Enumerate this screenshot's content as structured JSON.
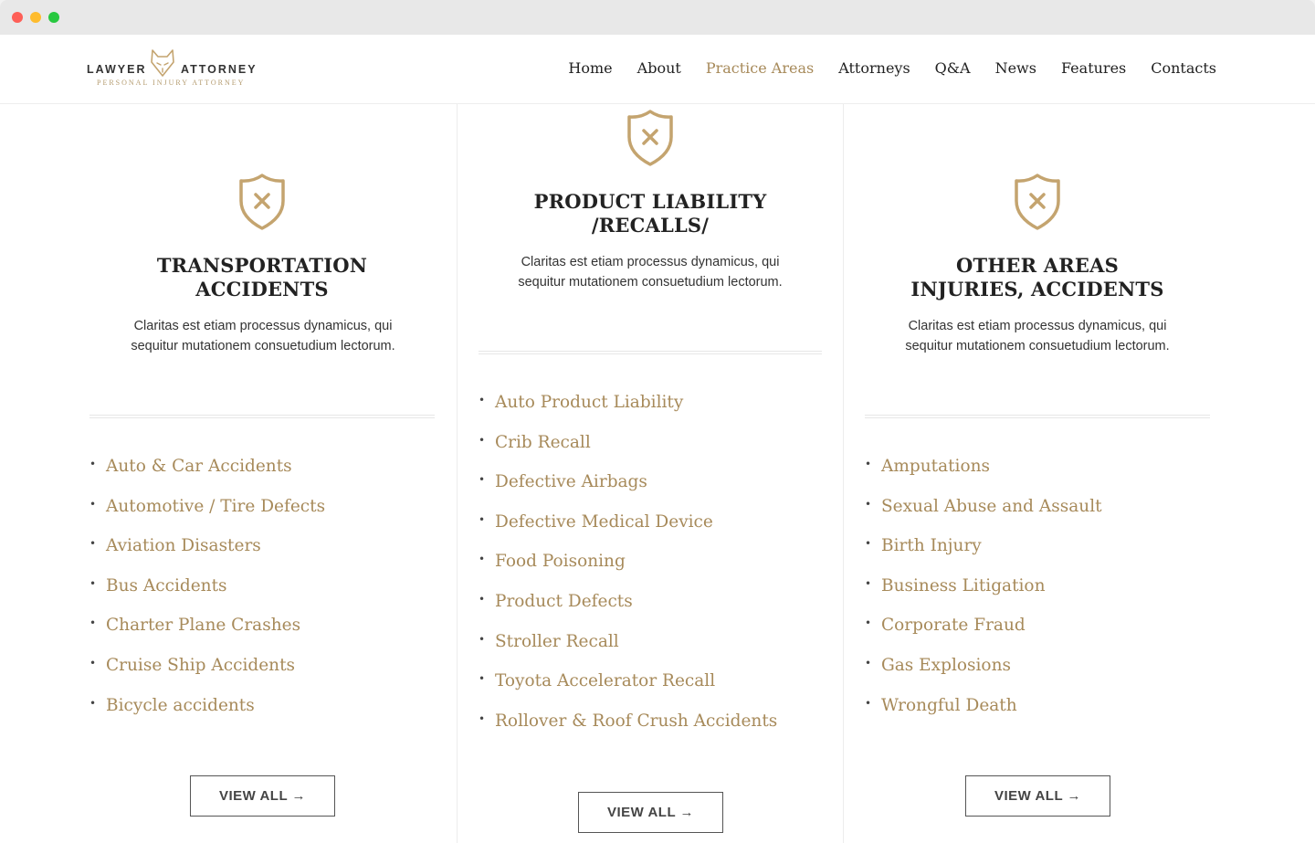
{
  "logo": {
    "left_word": "LAWYER",
    "right_word": "ATTORNEY",
    "tagline": "PERSONAL INJURY ATTORNEY"
  },
  "nav": [
    {
      "label": "Home",
      "active": false
    },
    {
      "label": "About",
      "active": false
    },
    {
      "label": "Practice Areas",
      "active": true
    },
    {
      "label": "Attorneys",
      "active": false
    },
    {
      "label": "Q&A",
      "active": false
    },
    {
      "label": "News",
      "active": false
    },
    {
      "label": "Features",
      "active": false
    },
    {
      "label": "Contacts",
      "active": false
    }
  ],
  "colors": {
    "accent": "#a78a5a",
    "text": "#222222"
  },
  "columns": [
    {
      "icon": "shield-x-icon",
      "title_line1": "TRANSPORTATION",
      "title_line2": "ACCIDENTS",
      "description": "Claritas est etiam processus dynamicus, qui sequitur mutationem consuetudium lectorum.",
      "items": [
        "Auto & Car Accidents",
        "Automotive / Tire Defects",
        "Aviation Disasters",
        "Bus Accidents",
        "Charter Plane Crashes",
        "Cruise Ship Accidents",
        "Bicycle accidents"
      ],
      "button": "VIEW ALL →"
    },
    {
      "icon": "shield-x-icon",
      "title_line1": "PRODUCT LIABILITY",
      "title_line2": "/RECALLS/",
      "description": "Claritas est etiam processus dynamicus, qui sequitur mutationem consuetudium lectorum.",
      "items": [
        "Auto Product Liability",
        "Crib Recall",
        "Defective Airbags",
        "Defective Medical Device",
        "Food Poisoning",
        "Product Defects",
        "Stroller Recall",
        "Toyota Accelerator Recall",
        "Rollover & Roof Crush Accidents"
      ],
      "button": "VIEW ALL →"
    },
    {
      "icon": "shield-x-icon",
      "title_line1": "OTHER AREAS",
      "title_line2": "INJURIES, ACCIDENTS",
      "description": "Claritas est etiam processus dynamicus, qui sequitur mutationem consuetudium lectorum.",
      "items": [
        "Amputations",
        "Sexual Abuse and Assault",
        "Birth Injury",
        "Business Litigation",
        "Corporate Fraud",
        "Gas Explosions",
        "Wrongful Death"
      ],
      "button": "VIEW ALL →"
    }
  ]
}
